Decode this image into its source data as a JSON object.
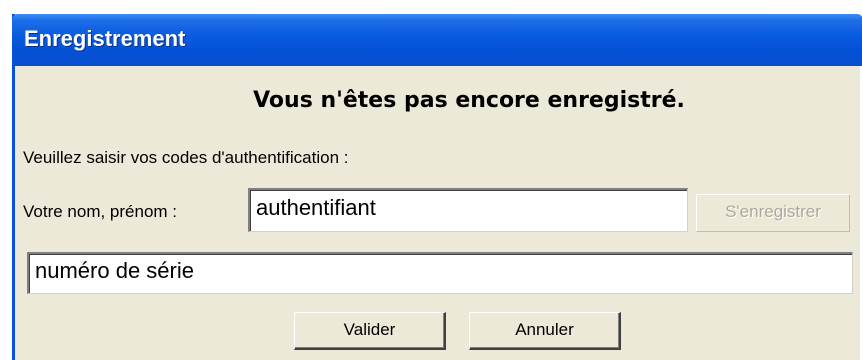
{
  "window": {
    "title": "Enregistrement"
  },
  "dialog": {
    "heading": "Vous n'êtes pas encore enregistré.",
    "instruction": "Veuillez saisir vos codes d'authentification :",
    "name_label": "Votre nom, prénom :",
    "name_value": "authentifiant",
    "serial_value": "numéro de série"
  },
  "buttons": {
    "register_label": "S'enregistrer",
    "register_enabled": false,
    "ok_label": "Valider",
    "cancel_label": "Annuler"
  },
  "colors": {
    "titlebar": "#0a5ce0",
    "dialog_background": "#ece9d8",
    "disabled_text": "#aca899"
  }
}
